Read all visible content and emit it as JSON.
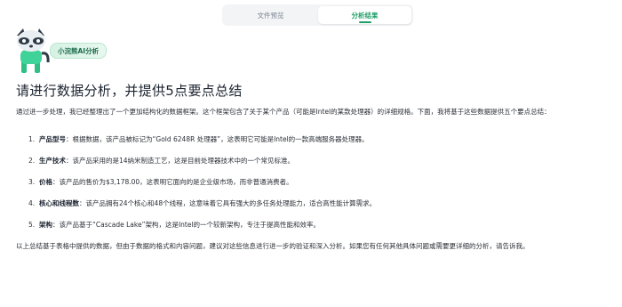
{
  "tabs": [
    {
      "label": "文件预览",
      "active": false
    },
    {
      "label": "分析结果",
      "active": true
    }
  ],
  "assistant": {
    "name": "小浣熊AI分析"
  },
  "heading": "请进行数据分析，并提供5点要点总结",
  "intro": "通过进一步处理，我已经整理出了一个更加结构化的数据框架。这个框架包含了关于某个产品（可能是Intel的某款处理器）的详细规格。下面，我将基于这些数据提供五个要点总结：",
  "points": [
    {
      "num": "1.",
      "term": "产品型号",
      "text": "：根据数据，该产品被标记为“Gold 6248R 处理器”，这表明它可能是Intel的一款高端服务器处理器。"
    },
    {
      "num": "2.",
      "term": "生产技术",
      "text": "：该产品采用的是14纳米制造工艺，这是目前处理器技术中的一个常见标准。"
    },
    {
      "num": "3.",
      "term": "价格",
      "text": "：该产品的售价为$3,178.00，这表明它面向的是企业级市场，而非普通消费者。"
    },
    {
      "num": "4.",
      "term": "核心和线程数",
      "text": "：该产品拥有24个核心和48个线程，这意味着它具有强大的多任务处理能力，适合高性能计算需求。"
    },
    {
      "num": "5.",
      "term": "架构",
      "text": "：该产品基于“Cascade Lake”架构，这是Intel的一个较新架构，专注于提高性能和效率。"
    }
  ],
  "outro": "以上总结基于表格中提供的数据，但由于数据的格式和内容问题，建议对这些信息进行进一步的验证和深入分析。如果您有任何其他具体问题或需要更详细的分析，请告诉我。",
  "colors": {
    "accent": "#1f9d68",
    "badge_bg": "#d6f2e4"
  }
}
